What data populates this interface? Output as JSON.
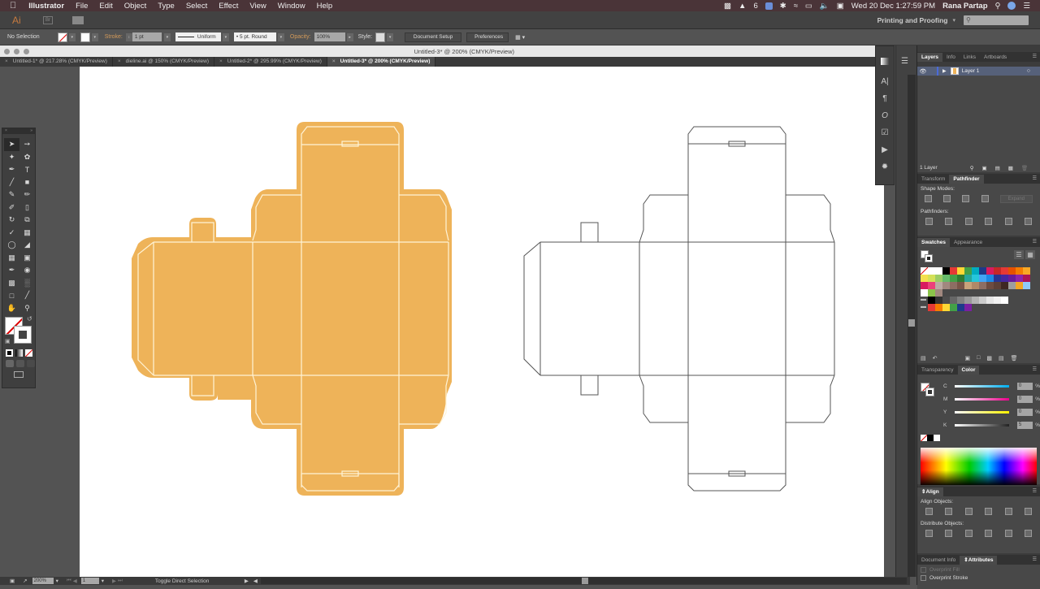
{
  "menubar": {
    "apple": "",
    "app_name": "Illustrator",
    "items": [
      "File",
      "Edit",
      "Object",
      "Type",
      "Select",
      "Effect",
      "View",
      "Window",
      "Help"
    ],
    "status_icons": [
      "film-icon",
      "adobe-icon",
      "notification-count-icon",
      "finder-icon",
      "bluetooth-icon",
      "wifi-icon",
      "airplay-icon",
      "volume-icon",
      "flag-icon"
    ],
    "notification_count": "6",
    "datetime": "Wed 20 Dec  1:27:59 PM",
    "user": "Rana Partap"
  },
  "appbar": {
    "logo": "Ai",
    "bridge": "Br",
    "workspace": "Printing and Proofing",
    "search_placeholder": ""
  },
  "control_bar": {
    "selection": "No Selection",
    "stroke_label": "Stroke:",
    "stroke_weight": "1 pt",
    "stroke_profile": "Uniform",
    "brush": "5 pt. Round",
    "opacity_label": "Opacity:",
    "opacity": "100%",
    "style_label": "Style:",
    "document_setup": "Document Setup",
    "preferences": "Preferences"
  },
  "document": {
    "window_title": "Untitled-3* @ 200% (CMYK/Preview)",
    "tabs": [
      {
        "label": "Untitled-1* @ 217.28% (CMYK/Preview)",
        "active": false
      },
      {
        "label": "dieline.ai @ 150% (CMYK/Preview)",
        "active": false
      },
      {
        "label": "Untitled-2* @ 295.99% (CMYK/Preview)",
        "active": false
      },
      {
        "label": "Untitled-3* @ 200% (CMYK/Preview)",
        "active": true
      }
    ]
  },
  "artwork": {
    "fill_color": "#EEB359",
    "inner_line_color": "#FFF3D6",
    "outline_color": "#555555"
  },
  "tools": [
    "selection-tool",
    "direct-selection-tool",
    "magic-wand-tool",
    "lasso-tool",
    "pen-tool",
    "type-tool",
    "line-tool",
    "rectangle-tool",
    "paintbrush-tool",
    "pencil-tool",
    "shaper-tool",
    "eraser-tool",
    "rotate-tool",
    "scale-tool",
    "warp-tool",
    "free-transform-tool",
    "shape-builder-tool",
    "perspective-grid-tool",
    "mesh-tool",
    "gradient-tool",
    "eyedropper-tool",
    "blend-tool",
    "symbol-sprayer-tool",
    "column-graph-tool",
    "artboard-tool",
    "slice-tool",
    "hand-tool",
    "zoom-tool"
  ],
  "layers_panel": {
    "tabs": [
      "Layers",
      "Info",
      "Links",
      "Artboards"
    ],
    "active_tab": "Layers",
    "layers": [
      {
        "name": "Layer 1",
        "visible": true
      }
    ],
    "count": "1 Layer"
  },
  "pathfinder_panel": {
    "tabs": [
      "Transform",
      "Pathfinder"
    ],
    "active_tab": "Pathfinder",
    "shape_modes_label": "Shape Modes:",
    "expand_label": "Expand",
    "pathfinders_label": "Pathfinders:"
  },
  "swatches_panel": {
    "tabs": [
      "Swatches",
      "Appearance"
    ],
    "active_tab": "Swatches",
    "rows": [
      [
        "none",
        "#FFFFFF",
        "#FFFFFF",
        "#000000",
        "#E53935",
        "#FDD835",
        "#43A047",
        "#00ACC1",
        "#1E3A8A",
        "#D81B60",
        "#C62828",
        "#E53935",
        "#E65100",
        "#F57C00",
        "#F9A825"
      ],
      [
        "#F4E04D",
        "#D4E157",
        "#9CCC65",
        "#66BB6A",
        "#43A047",
        "#2E7D32",
        "#26A69A",
        "#26C6DA",
        "#42A5F5",
        "#1E88E5",
        "#283593",
        "#4527A0",
        "#6A1B9A",
        "#8E24AA",
        "#AD1457"
      ],
      [
        "#D81B60",
        "#EC407A",
        "#BCAAA4",
        "#A1887F",
        "#8D6E63",
        "#795548",
        "#C8A27A",
        "#B08968",
        "#8D6E63",
        "#6D4C41",
        "#5D4037",
        "#3E2723",
        "#9E9E9E",
        "#F5A623",
        "#90CAF9"
      ],
      [
        "#FFFFFF",
        "#8BC34A",
        "#A1887F"
      ],
      [
        "folder",
        "#000000",
        "#333333",
        "#4D4D4D",
        "#666666",
        "#808080",
        "#999999",
        "#B3B3B3",
        "#CCCCCC",
        "#E6E6E6",
        "#F2F2F2",
        "#FFFFFF"
      ],
      [
        "folder",
        "#E53935",
        "#F57C00",
        "#FDD835",
        "#43A047",
        "#1E3A8A",
        "#7B1FA2"
      ]
    ]
  },
  "color_panel": {
    "tabs": [
      "Transparency",
      "Color"
    ],
    "active_tab": "Color",
    "channels": [
      {
        "label": "C",
        "value": "0",
        "color": "#00AEEF"
      },
      {
        "label": "M",
        "value": "0",
        "color": "#EC008C"
      },
      {
        "label": "Y",
        "value": "0",
        "color": "#FFF200"
      },
      {
        "label": "K",
        "value": "5",
        "color": "#000000"
      }
    ],
    "unit": "%"
  },
  "align_panel": {
    "title": "Align",
    "align_objects_label": "Align Objects:",
    "distribute_objects_label": "Distribute Objects:"
  },
  "attributes_panel": {
    "tabs": [
      "Document Info",
      "Attributes"
    ],
    "active_tab": "Attributes",
    "overprint_fill": "Overprint Fill",
    "overprint_stroke": "Overprint Stroke"
  },
  "status_bar": {
    "zoom": "200%",
    "artboard": "1",
    "current_tool": "Toggle Direct Selection"
  }
}
